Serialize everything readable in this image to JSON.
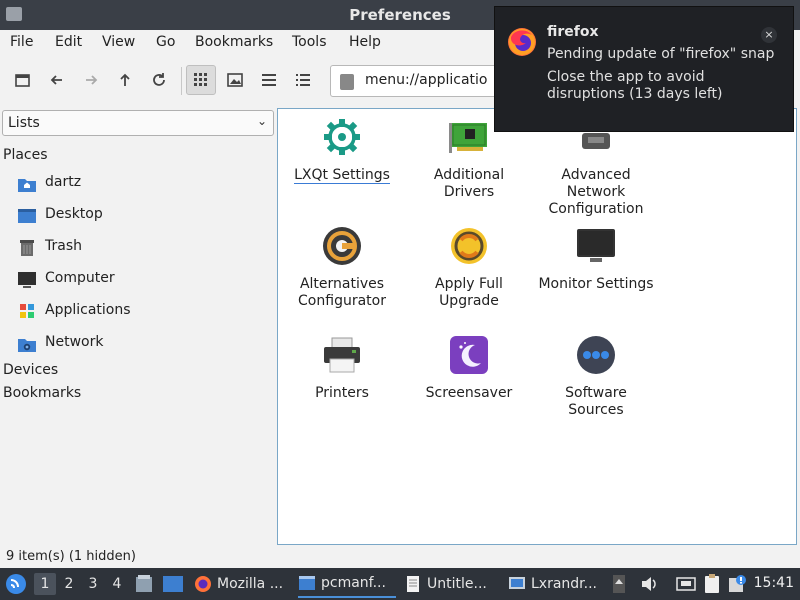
{
  "window": {
    "title": "Preferences"
  },
  "menu": [
    "File",
    "Edit",
    "View",
    "Go",
    "Bookmarks",
    "Tools",
    "Help"
  ],
  "address": {
    "value": "menu://applicatio"
  },
  "sidepane": {
    "selector": "Lists",
    "places_header": "Places",
    "places": [
      {
        "label": "dartz",
        "icon": "home-folder-icon"
      },
      {
        "label": "Desktop",
        "icon": "desktop-icon"
      },
      {
        "label": "Trash",
        "icon": "trash-icon"
      },
      {
        "label": "Computer",
        "icon": "computer-icon"
      },
      {
        "label": "Applications",
        "icon": "applications-icon"
      },
      {
        "label": "Network",
        "icon": "network-folder-icon"
      }
    ],
    "devices_header": "Devices",
    "bookmarks_header": "Bookmarks"
  },
  "items": [
    {
      "label": "LXQt Settings",
      "icon": "lxqt-settings-icon"
    },
    {
      "label": "Additional\nDrivers",
      "icon": "drivers-card-icon"
    },
    {
      "label": "Advanced\nNetwork\nConfiguration",
      "icon": "network-config-icon"
    },
    {
      "label": "Alternatives\nConfigurator",
      "icon": "alternatives-icon"
    },
    {
      "label": "Apply Full\nUpgrade",
      "icon": "upgrade-icon"
    },
    {
      "label": "Monitor Settings",
      "icon": "monitor-icon"
    },
    {
      "label": "Printers",
      "icon": "printer-icon"
    },
    {
      "label": "Screensaver",
      "icon": "screensaver-icon"
    },
    {
      "label": "Software\nSources",
      "icon": "software-sources-icon"
    }
  ],
  "status": {
    "text": "9 item(s) (1 hidden)"
  },
  "taskbar": {
    "desktops": [
      "1",
      "2",
      "3",
      "4"
    ],
    "tasks": [
      "Mozilla ...",
      "pcmanf...",
      "Untitle...",
      "Lxrandr..."
    ],
    "clock": "15:41"
  },
  "notification": {
    "app": "firefox",
    "line1": "Pending update of \"firefox\" snap",
    "line2": "Close the app to avoid disruptions (13 days left)",
    "close_icon": "close-icon"
  },
  "colors": {
    "titlebar": "#3a3f47",
    "taskbar": "#2e333a",
    "notification": "#1f2125",
    "selection_border": "#7aa7c7"
  }
}
